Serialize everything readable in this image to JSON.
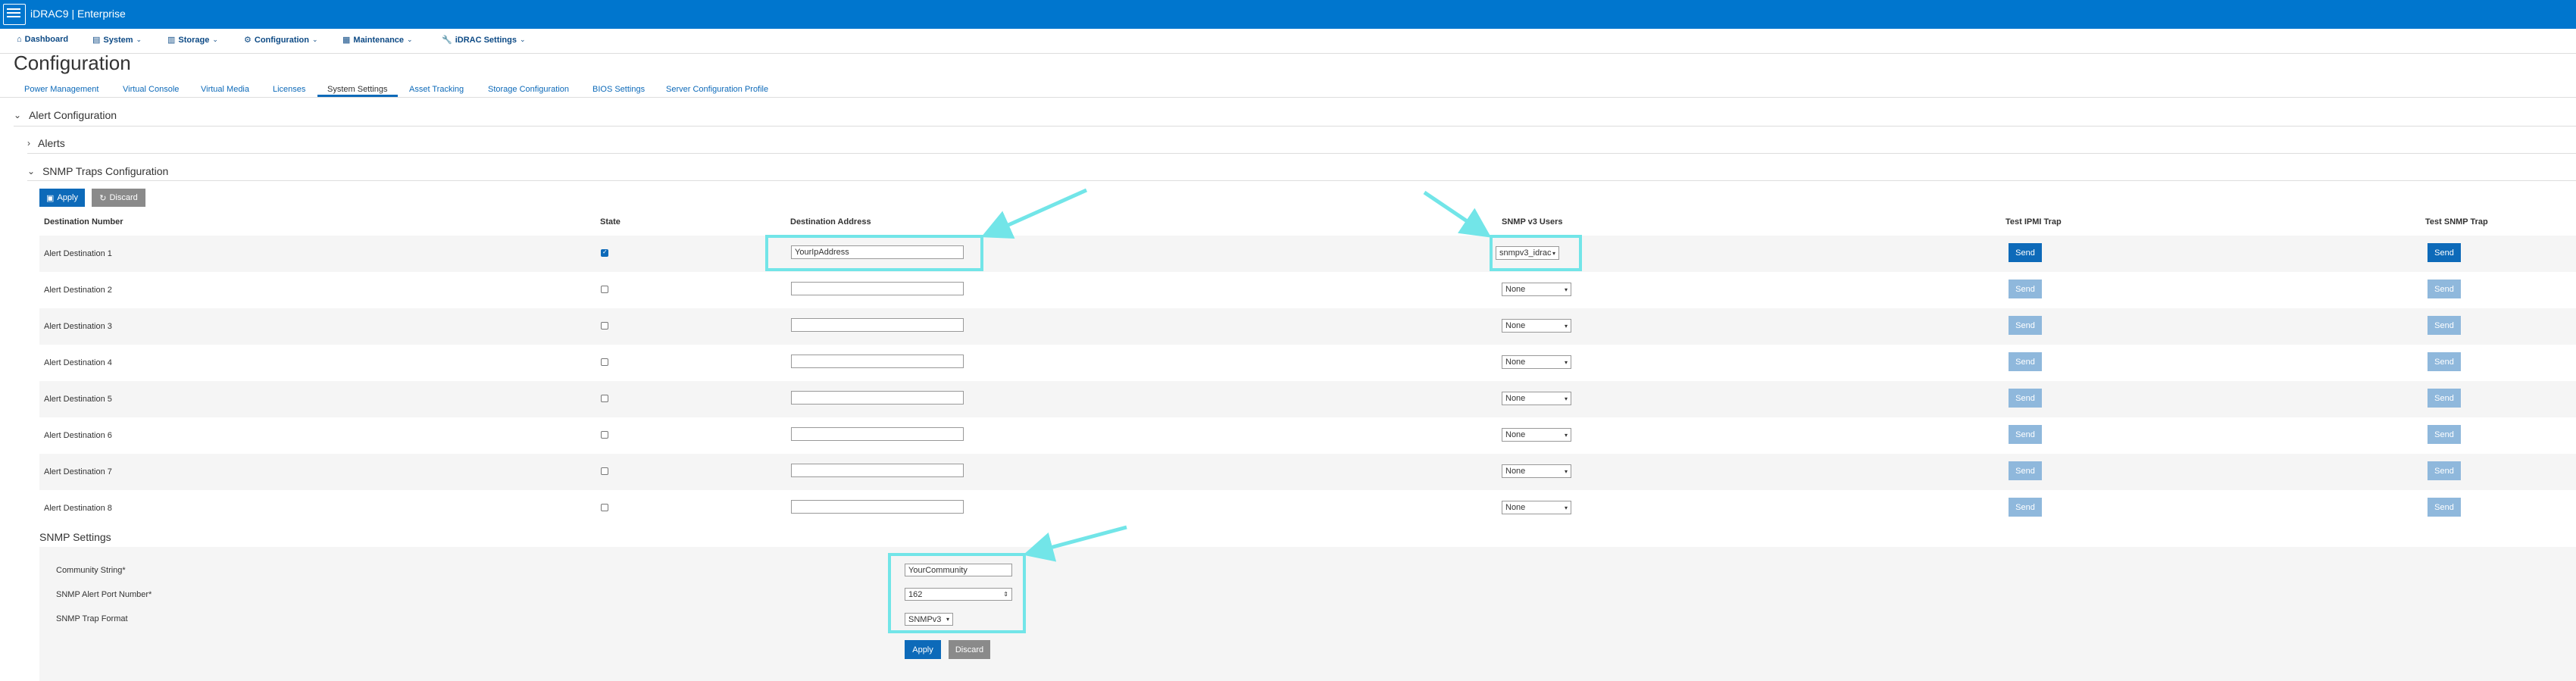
{
  "app": {
    "brand": "iDRAC9 | Enterprise"
  },
  "nav": [
    {
      "label": "Dashboard",
      "icon": "home-icon"
    },
    {
      "label": "System",
      "icon": "server-icon"
    },
    {
      "label": "Storage",
      "icon": "storage-icon"
    },
    {
      "label": "Configuration",
      "icon": "configuration-icon"
    },
    {
      "label": "Maintenance",
      "icon": "maintenance-icon"
    },
    {
      "label": "iDRAC Settings",
      "icon": "settings-icon"
    }
  ],
  "page": {
    "title": "Configuration"
  },
  "tabs": [
    {
      "label": "Power Management"
    },
    {
      "label": "Virtual Console"
    },
    {
      "label": "Virtual Media"
    },
    {
      "label": "Licenses"
    },
    {
      "label": "System Settings",
      "active": true
    },
    {
      "label": "Asset Tracking"
    },
    {
      "label": "Storage Configuration"
    },
    {
      "label": "BIOS Settings"
    },
    {
      "label": "Server Configuration Profile"
    }
  ],
  "sections": {
    "alert_configuration": "Alert Configuration",
    "alerts": "Alerts",
    "snmp_traps": "SNMP Traps Configuration",
    "snmp_settings": "SNMP Settings"
  },
  "toolbar": {
    "apply": "Apply",
    "discard": "Discard"
  },
  "table": {
    "headers": {
      "destination_number": "Destination Number",
      "state": "State",
      "destination_address": "Destination Address",
      "snmp_users": "SNMP v3 Users",
      "test_ipmi": "Test IPMI Trap",
      "test_snmp": "Test SNMP Trap"
    },
    "send_label": "Send",
    "rows": [
      {
        "name": "Alert Destination 1",
        "state": true,
        "address": "YourIpAddress",
        "user": "snmpv3_idrac"
      },
      {
        "name": "Alert Destination 2",
        "state": false,
        "address": "",
        "user": "None"
      },
      {
        "name": "Alert Destination 3",
        "state": false,
        "address": "",
        "user": "None"
      },
      {
        "name": "Alert Destination 4",
        "state": false,
        "address": "",
        "user": "None"
      },
      {
        "name": "Alert Destination 5",
        "state": false,
        "address": "",
        "user": "None"
      },
      {
        "name": "Alert Destination 6",
        "state": false,
        "address": "",
        "user": "None"
      },
      {
        "name": "Alert Destination 7",
        "state": false,
        "address": "",
        "user": "None"
      },
      {
        "name": "Alert Destination 8",
        "state": false,
        "address": "",
        "user": "None"
      }
    ]
  },
  "snmp_settings": {
    "community_label": "Community String*",
    "community_value": "YourCommunity",
    "port_label": "SNMP Alert Port Number*",
    "port_value": "162",
    "format_label": "SNMP Trap Format",
    "format_value": "SNMPv3",
    "apply": "Apply",
    "discard": "Discard"
  },
  "colors": {
    "brand_blue": "#0076ce",
    "primary_button": "#0d6ab9",
    "disabled_button": "#8fb8dc",
    "highlight": "#72e5e8"
  }
}
